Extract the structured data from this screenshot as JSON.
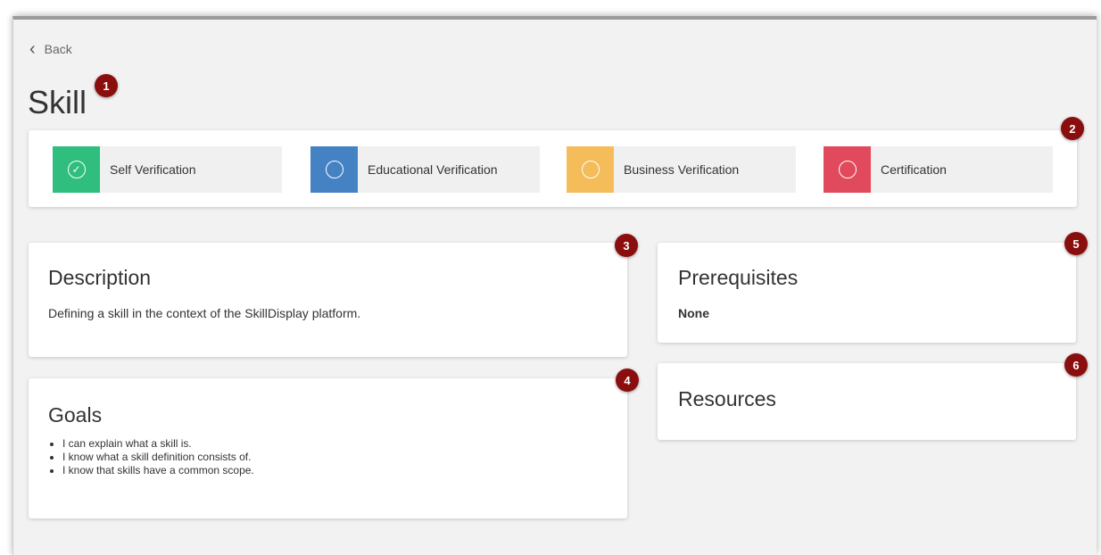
{
  "nav": {
    "back_label": "Back"
  },
  "page": {
    "title": "Skill"
  },
  "verifications": [
    {
      "label": "Self Verification",
      "color": "#2fbe7e",
      "icon": "check-circle-icon",
      "state": "complete"
    },
    {
      "label": "Educational Verification",
      "color": "#4582c4",
      "icon": "circle-icon",
      "state": "pending"
    },
    {
      "label": "Business Verification",
      "color": "#f5bc5a",
      "icon": "circle-icon",
      "state": "pending"
    },
    {
      "label": "Certification",
      "color": "#e14a5c",
      "icon": "circle-icon",
      "state": "pending"
    }
  ],
  "description": {
    "heading": "Description",
    "text": "Defining a skill in the context of the SkillDisplay platform."
  },
  "goals": {
    "heading": "Goals",
    "items": [
      "I can explain what a skill is.",
      "I know what a skill definition consists of.",
      "I know that skills have a common scope."
    ]
  },
  "prerequisites": {
    "heading": "Prerequisites",
    "value": "None"
  },
  "resources": {
    "heading": "Resources"
  },
  "annotations": [
    "1",
    "2",
    "3",
    "4",
    "5",
    "6"
  ],
  "colors": {
    "badge": "#8b0e0e",
    "background": "#f2f2f2"
  }
}
